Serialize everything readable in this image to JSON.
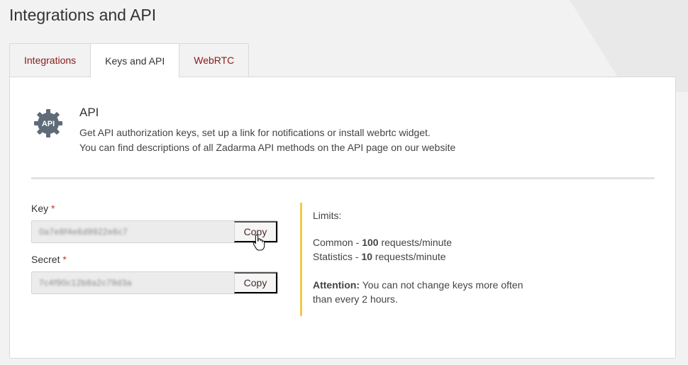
{
  "page": {
    "title": "Integrations and API"
  },
  "tabs": [
    {
      "label": "Integrations",
      "active": false
    },
    {
      "label": "Keys and API",
      "active": true
    },
    {
      "label": "WebRTC",
      "active": false
    }
  ],
  "api": {
    "icon_label": "API",
    "title": "API",
    "description_line1": "Get API authorization keys, set up a link for notifications or install webrtc widget.",
    "description_line2": "You can find descriptions of all Zadarma API methods on the API page on our website"
  },
  "key": {
    "label": "Key",
    "required_mark": "*",
    "value": "0a7e8f4e6d9922e6c7",
    "copy_label": "Copy"
  },
  "secret": {
    "label": "Secret",
    "required_mark": "*",
    "value": "7c4f90c12b8a2c79d3a",
    "copy_label": "Copy"
  },
  "limits": {
    "heading": "Limits:",
    "common_prefix": "Common - ",
    "common_value": "100",
    "common_suffix": " requests/minute",
    "stats_prefix": "Statistics - ",
    "stats_value": "10",
    "stats_suffix": " requests/minute",
    "attention_label": "Attention:",
    "attention_text_line1": " You can not change keys more often",
    "attention_text_line2": "than every 2 hours."
  },
  "colors": {
    "accent_border": "#f2c94c",
    "tab_link": "#8b1a1a",
    "required": "#c0392b",
    "icon_gear": "#5f6b78"
  }
}
